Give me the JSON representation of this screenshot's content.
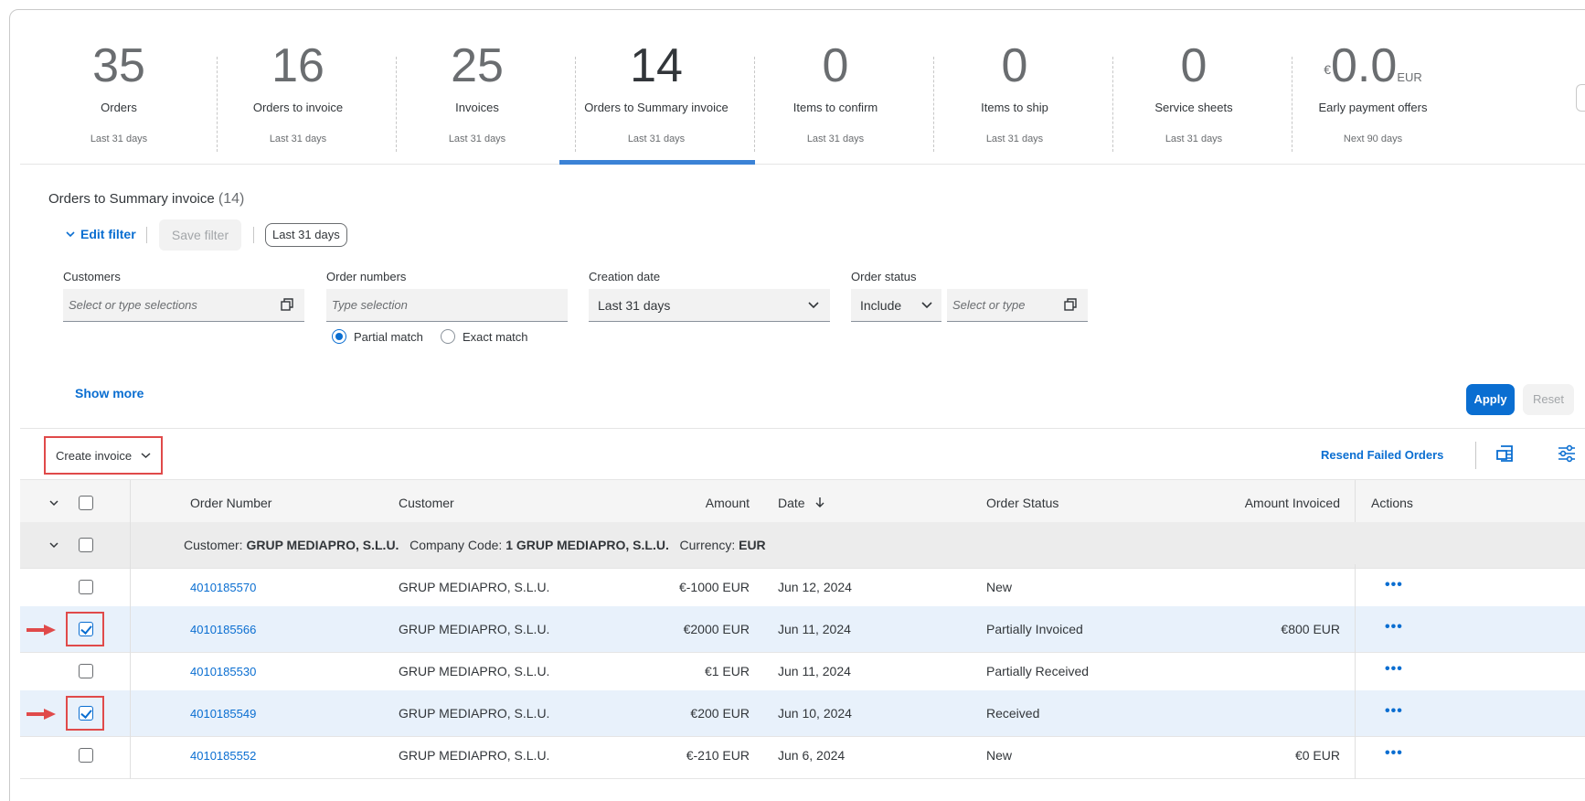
{
  "tiles": [
    {
      "num": "35",
      "label": "Orders",
      "sub": "Last 31 days"
    },
    {
      "num": "16",
      "label": "Orders to invoice",
      "sub": "Last 31 days"
    },
    {
      "num": "25",
      "label": "Invoices",
      "sub": "Last 31 days"
    },
    {
      "num": "14",
      "label": "Orders to Summary invoice",
      "sub": "Last 31 days"
    },
    {
      "num": "0",
      "label": "Items to confirm",
      "sub": "Last 31 days"
    },
    {
      "num": "0",
      "label": "Items to ship",
      "sub": "Last 31 days"
    },
    {
      "num": "0",
      "label": "Service sheets",
      "sub": "Last 31 days"
    },
    {
      "num": "0.0",
      "currency_symbol": "€",
      "currency_code": "EUR",
      "label": "Early payment offers",
      "sub": "Next 90 days"
    }
  ],
  "active_tile": "Orders to Summary invoice",
  "filter": {
    "title": "Orders to Summary invoice",
    "count": "(14)",
    "edit_filter": "Edit filter",
    "save_filter": "Save filter",
    "chip": "Last 31 days",
    "customers": {
      "label": "Customers",
      "placeholder": "Select or type selections"
    },
    "order_numbers": {
      "label": "Order numbers",
      "placeholder": "Type selection"
    },
    "creation_date": {
      "label": "Creation date",
      "value": "Last 31 days"
    },
    "order_status": {
      "label": "Order status",
      "mode": "Include",
      "placeholder": "Select or type"
    },
    "match": {
      "partial": "Partial match",
      "exact": "Exact match",
      "selected": "Partial match"
    },
    "show_more": "Show more",
    "apply": "Apply",
    "reset": "Reset"
  },
  "toolbar": {
    "create_invoice": "Create invoice",
    "resend_failed": "Resend Failed Orders"
  },
  "table": {
    "headers": {
      "order_number": "Order Number",
      "customer": "Customer",
      "amount": "Amount",
      "date": "Date",
      "order_status": "Order Status",
      "amount_invoiced": "Amount Invoiced",
      "actions": "Actions"
    },
    "group": {
      "customer_label": "Customer:",
      "customer": "GRUP MEDIAPRO, S.L.U.",
      "company_label": "Company Code:",
      "company": "1 GRUP MEDIAPRO, S.L.U.",
      "currency_label": "Currency:",
      "currency": "EUR"
    },
    "rows": [
      {
        "order": "4010185570",
        "customer": "GRUP MEDIAPRO, S.L.U.",
        "amount": "€-1000 EUR",
        "date": "Jun 12, 2024",
        "status": "New",
        "invoiced": "",
        "checked": false
      },
      {
        "order": "4010185566",
        "customer": "GRUP MEDIAPRO, S.L.U.",
        "amount": "€2000 EUR",
        "date": "Jun 11, 2024",
        "status": "Partially Invoiced",
        "invoiced": "€800 EUR",
        "checked": true
      },
      {
        "order": "4010185530",
        "customer": "GRUP MEDIAPRO, S.L.U.",
        "amount": "€1 EUR",
        "date": "Jun 11, 2024",
        "status": "Partially Received",
        "invoiced": "",
        "checked": false
      },
      {
        "order": "4010185549",
        "customer": "GRUP MEDIAPRO, S.L.U.",
        "amount": "€200 EUR",
        "date": "Jun 10, 2024",
        "status": "Received",
        "invoiced": "",
        "checked": true
      },
      {
        "order": "4010185552",
        "customer": "GRUP MEDIAPRO, S.L.U.",
        "amount": "€-210 EUR",
        "date": "Jun 6, 2024",
        "status": "New",
        "invoiced": "€0 EUR",
        "checked": false
      }
    ]
  },
  "colors": {
    "accent": "#0a6ed1",
    "highlight_box": "#e04a4a",
    "selected_row": "#e8f1fb"
  }
}
